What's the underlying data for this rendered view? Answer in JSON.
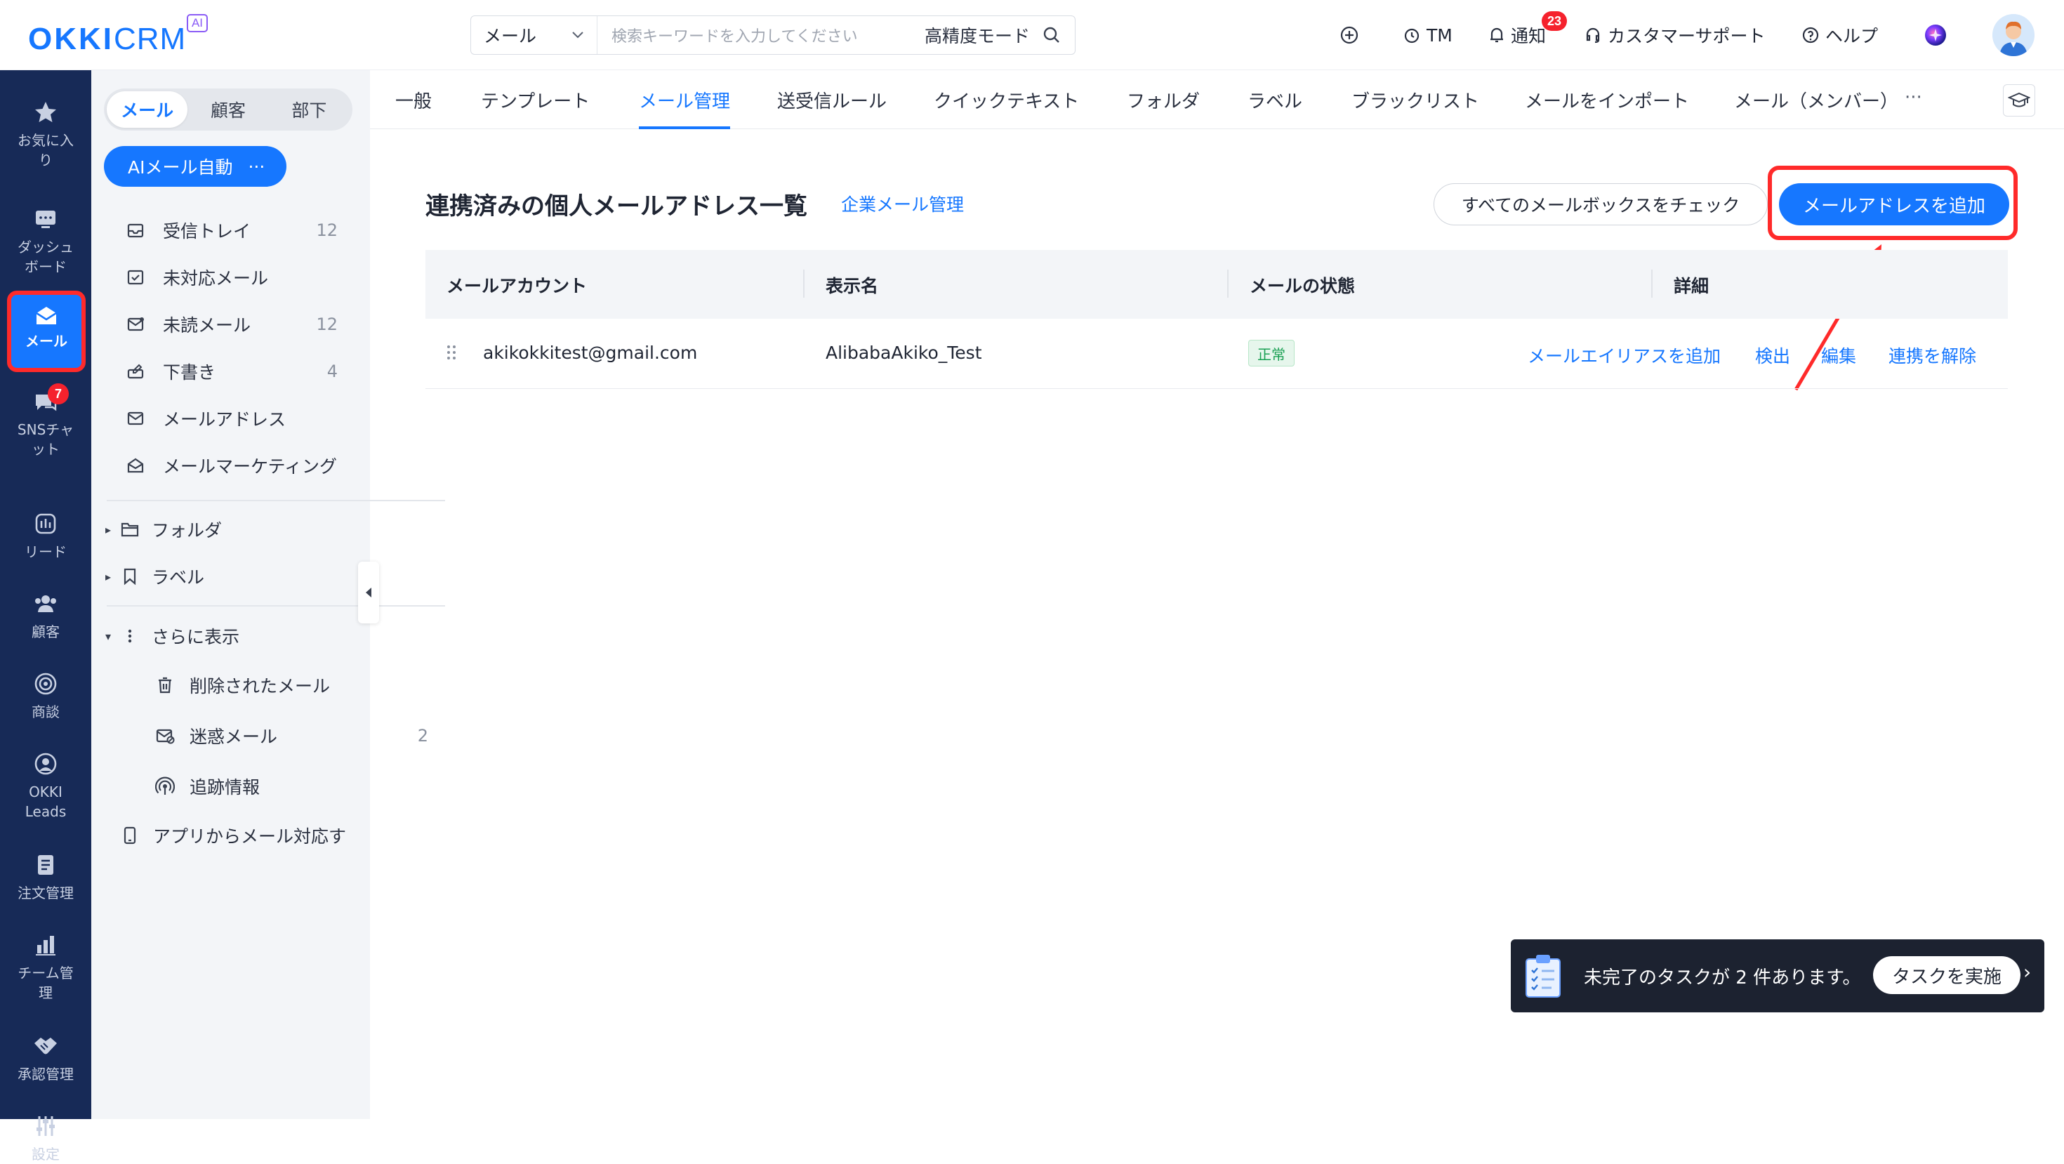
{
  "app": {
    "logo_main": "OKKI",
    "logo_sub": "CRM",
    "logo_ai": "AI"
  },
  "header": {
    "search_scope": "メール",
    "search_placeholder": "検索キーワードを入力してください",
    "search_mode": "高精度モード",
    "tm_label": "TM",
    "notify_label": "通知",
    "notify_count": "23",
    "support_label": "カスタマーサポート",
    "help_label": "ヘルプ"
  },
  "nav": {
    "items": [
      {
        "label": "お気に入り",
        "icon": "star-icon"
      },
      {
        "label": "ダッシュボード",
        "icon": "dashboard-icon"
      },
      {
        "label": "メール",
        "icon": "mail-icon"
      },
      {
        "label": "SNSチャット",
        "icon": "chat-icon",
        "badge": "7"
      },
      {
        "label": "リード",
        "icon": "lead-icon"
      },
      {
        "label": "顧客",
        "icon": "customers-icon"
      },
      {
        "label": "商談",
        "icon": "target-icon"
      },
      {
        "label": "OKKI Leads",
        "icon": "okki-leads-icon"
      },
      {
        "label": "注文管理",
        "icon": "order-icon"
      },
      {
        "label": "チーム管理",
        "icon": "team-chart-icon"
      },
      {
        "label": "承認管理",
        "icon": "handshake-icon"
      },
      {
        "label": "設定",
        "icon": "settings-icon"
      }
    ]
  },
  "sidebar": {
    "segments": [
      "メール",
      "顧客",
      "部下"
    ],
    "ai_button": "AIメール自動",
    "ai_more": "···",
    "mail_items": [
      {
        "label": "受信トレイ",
        "count": "12",
        "icon": "inbox-icon"
      },
      {
        "label": "未対応メール",
        "count": "",
        "icon": "pending-mail-icon"
      },
      {
        "label": "未読メール",
        "count": "12",
        "icon": "unread-mail-icon"
      },
      {
        "label": "下書き",
        "count": "4",
        "icon": "draft-icon"
      },
      {
        "label": "メールアドレス",
        "count": "",
        "icon": "mail-address-icon"
      },
      {
        "label": "メールマーケティング",
        "count": "",
        "icon": "mail-marketing-icon"
      }
    ],
    "folder_label": "フォルダ",
    "label_label": "ラベル",
    "more_label": "さらに表示",
    "more_items": [
      {
        "label": "削除されたメール",
        "count": "",
        "icon": "trash-icon"
      },
      {
        "label": "迷惑メール",
        "count": "2",
        "icon": "spam-icon"
      },
      {
        "label": "追跡情報",
        "count": "",
        "icon": "tracking-icon"
      }
    ],
    "app_label": "アプリからメール対応す"
  },
  "tabs": {
    "items": [
      "一般",
      "テンプレート",
      "メール管理",
      "送受信ルール",
      "クイックテキスト",
      "フォルダ",
      "ラベル",
      "ブラックリスト",
      "メールをインポート",
      "メール（メンバー）"
    ],
    "active": "メール管理",
    "more": "···"
  },
  "main": {
    "title": "連携済みの個人メールアドレス一覧",
    "corp_link": "企業メール管理",
    "check_button": "すべてのメールボックスをチェック",
    "add_button": "メールアドレスを追加",
    "table": {
      "columns": [
        "メールアカウント",
        "表示名",
        "メールの状態",
        "詳細"
      ],
      "rows": [
        {
          "account": "akikokkitest@gmail.com",
          "display_name": "AlibabaAkiko_Test",
          "status": "正常",
          "actions": [
            "メールエイリアスを追加",
            "検出",
            "編集",
            "連携を解除"
          ]
        }
      ]
    }
  },
  "toast": {
    "message": "未完了のタスクが 2 件あります。",
    "button": "タスクを実施",
    "chevron": "›"
  },
  "colors": {
    "primary": "#1677ff",
    "nav_bg": "#172a57",
    "highlight": "#ff2a2a",
    "status_green": "#1aa053"
  }
}
